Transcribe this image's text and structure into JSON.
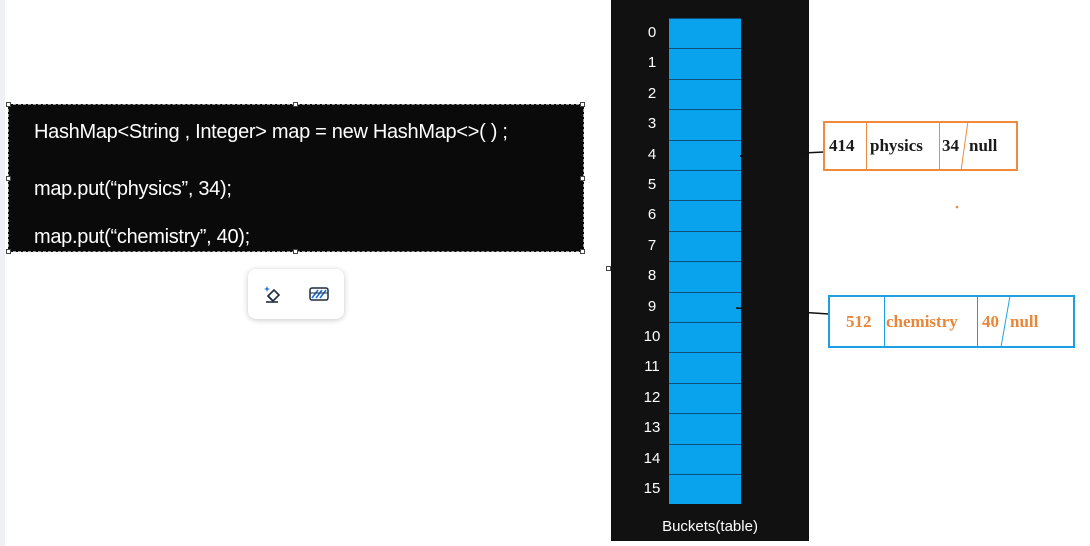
{
  "code": {
    "lines": [
      "HashMap<String , Integer> map = new HashMap<>( ) ;",
      "map.put(“physics”, 34);",
      "map.put(“chemistry”, 40);"
    ]
  },
  "toolbar": {
    "icons": [
      "eraser-sparkle-icon",
      "hatch-pattern-icon"
    ]
  },
  "buckets": {
    "indices": [
      "0",
      "1",
      "2",
      "3",
      "4",
      "5",
      "6",
      "7",
      "8",
      "9",
      "10",
      "11",
      "12",
      "13",
      "14",
      "15"
    ],
    "caption": "Buckets(table)"
  },
  "nodes": {
    "physics": {
      "hash": "414",
      "key": "physics",
      "value": "34",
      "next": "null",
      "bucket": 4
    },
    "chemistry": {
      "hash": "512",
      "key": "chemistry",
      "value": "40",
      "next": "null",
      "bucket": 9
    }
  },
  "colors": {
    "bucket": "#08a3ec",
    "panel": "#111111",
    "node_orange": "#f08a3c",
    "node_blue": "#1ba1e2",
    "orange_text": "#e8863a"
  }
}
